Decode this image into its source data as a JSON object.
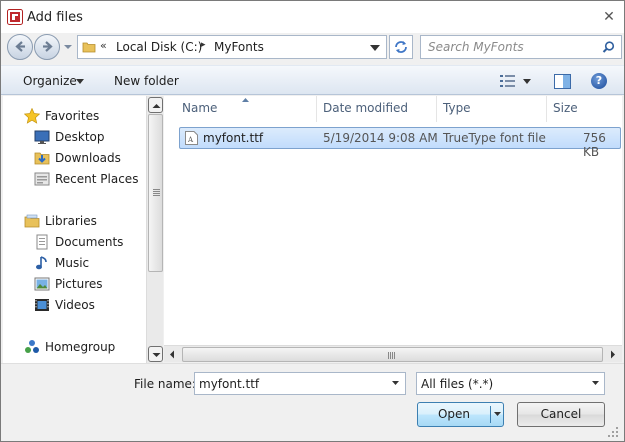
{
  "window": {
    "title": "Add files",
    "close_glyph": "✕"
  },
  "address": {
    "overflow_chevron": "«",
    "crumbs": [
      "Local Disk (C:)",
      "MyFonts"
    ],
    "separator": "▸"
  },
  "search": {
    "placeholder": "Search MyFonts"
  },
  "toolbar": {
    "organize_label": "Organize",
    "new_folder_label": "New folder",
    "help_glyph": "?"
  },
  "nav": {
    "favorites": {
      "label": "Favorites",
      "icon": "star-icon",
      "items": [
        {
          "label": "Desktop",
          "icon": "desktop-icon"
        },
        {
          "label": "Downloads",
          "icon": "downloads-icon"
        },
        {
          "label": "Recent Places",
          "icon": "recent-places-icon"
        }
      ]
    },
    "libraries": {
      "label": "Libraries",
      "icon": "libraries-icon",
      "items": [
        {
          "label": "Documents",
          "icon": "documents-icon"
        },
        {
          "label": "Music",
          "icon": "music-icon"
        },
        {
          "label": "Pictures",
          "icon": "pictures-icon"
        },
        {
          "label": "Videos",
          "icon": "videos-icon"
        }
      ]
    },
    "homegroup": {
      "label": "Homegroup",
      "icon": "homegroup-icon"
    }
  },
  "filelist": {
    "columns": [
      "Name",
      "Date modified",
      "Type",
      "Size"
    ],
    "rows": [
      {
        "name": "myfont.ttf",
        "date": "5/19/2014 9:08 AM",
        "type": "TrueType font file",
        "size": "756 KB",
        "selected": true
      }
    ]
  },
  "bottom": {
    "file_name_label": "File name:",
    "file_name_value": "myfont.ttf",
    "file_type_value": "All files (*.*)",
    "open_label": "Open",
    "cancel_label": "Cancel"
  },
  "colors": {
    "selection_bg": "#c1dcfc",
    "selection_border": "#7da2ce",
    "toolbar_bg": "#dde6f1",
    "header_text": "#4c607a"
  }
}
